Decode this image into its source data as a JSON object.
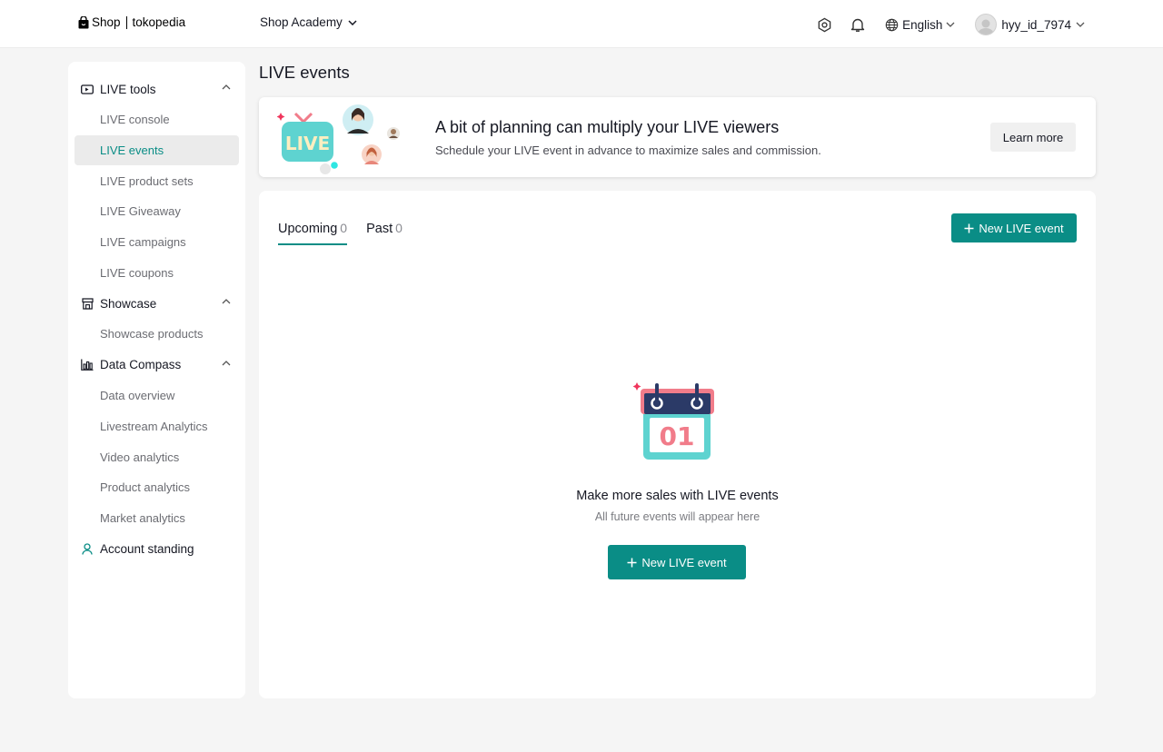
{
  "header": {
    "logo_shop": "Shop",
    "logo_partner": "tokopedia",
    "academy_label": "Shop Academy",
    "language": "English",
    "username": "hyy_id_7974"
  },
  "sidebar": {
    "sections": [
      {
        "title": "LIVE tools",
        "icon": "live-camera-icon",
        "items": [
          {
            "label": "LIVE console"
          },
          {
            "label": "LIVE events",
            "active": true
          },
          {
            "label": "LIVE product sets"
          },
          {
            "label": "LIVE Giveaway"
          },
          {
            "label": "LIVE campaigns"
          },
          {
            "label": "LIVE coupons"
          }
        ]
      },
      {
        "title": "Showcase",
        "icon": "storefront-icon",
        "items": [
          {
            "label": "Showcase products"
          }
        ]
      },
      {
        "title": "Data Compass",
        "icon": "bar-chart-icon",
        "items": [
          {
            "label": "Data overview"
          },
          {
            "label": "Livestream Analytics"
          },
          {
            "label": "Video analytics"
          },
          {
            "label": "Product analytics"
          },
          {
            "label": "Market analytics"
          }
        ]
      }
    ],
    "account_standing": "Account standing"
  },
  "main": {
    "title": "LIVE events",
    "banner": {
      "title": "A bit of planning can multiply your LIVE viewers",
      "subtitle": "Schedule your LIVE event in advance to maximize sales and commission.",
      "button": "Learn more",
      "art_text": "LIVE"
    },
    "tabs": [
      {
        "label": "Upcoming",
        "count": "0",
        "active": true
      },
      {
        "label": "Past",
        "count": "0"
      }
    ],
    "new_event_label": "New LIVE event",
    "empty": {
      "calendar_day": "01",
      "title": "Make more sales with LIVE events",
      "subtitle": "All future events will appear here",
      "button": "New LIVE event"
    }
  },
  "colors": {
    "accent": "#0a8d86",
    "calendar_teal": "#5ed3d0",
    "calendar_pink": "#f17c8a",
    "calendar_navy": "#2b3a67"
  }
}
